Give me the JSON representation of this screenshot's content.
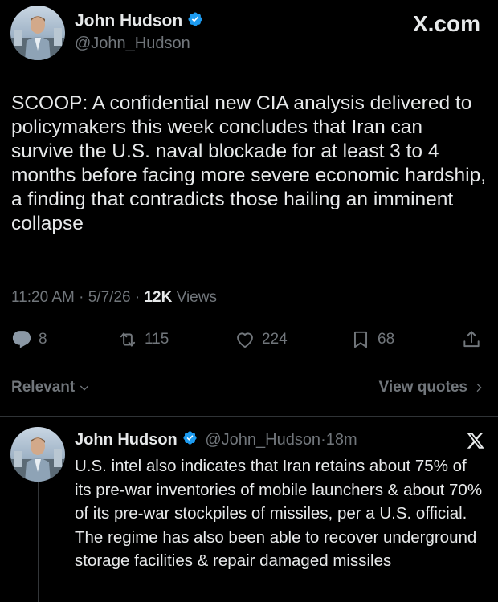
{
  "tweet": {
    "author_name": "John Hudson",
    "author_handle": "@John_Hudson",
    "brand": "X.com",
    "text": "SCOOP: A confidential new CIA analysis delivered to policymakers this week concludes that Iran can survive the U.S. naval blockade for at least 3 to 4 months before facing more severe economic hardship, a finding that contradicts those hailing an imminent collapse",
    "time": "11:20 AM",
    "date": "5/7/26",
    "views_count": "12K",
    "views_label": "Views",
    "replies": "8",
    "reposts": "115",
    "likes": "224",
    "bookmarks": "68"
  },
  "sort": {
    "label": "Relevant",
    "view_quotes": "View quotes"
  },
  "reply": {
    "author_name": "John Hudson",
    "author_handle": "@John_Hudson",
    "separator": "·",
    "age": "18m",
    "text": "U.S. intel also indicates that Iran retains about 75% of its pre-war inventories of mobile launchers & about 70% of its pre-war stockpiles of missiles, per a U.S. official. The regime has also been able to recover underground storage facilities & repair damaged missiles"
  },
  "colors": {
    "background": "#000000",
    "text": "#e7e9ea",
    "muted": "#71767b",
    "verified": "#1d9bf0",
    "divider": "#2f3336"
  }
}
